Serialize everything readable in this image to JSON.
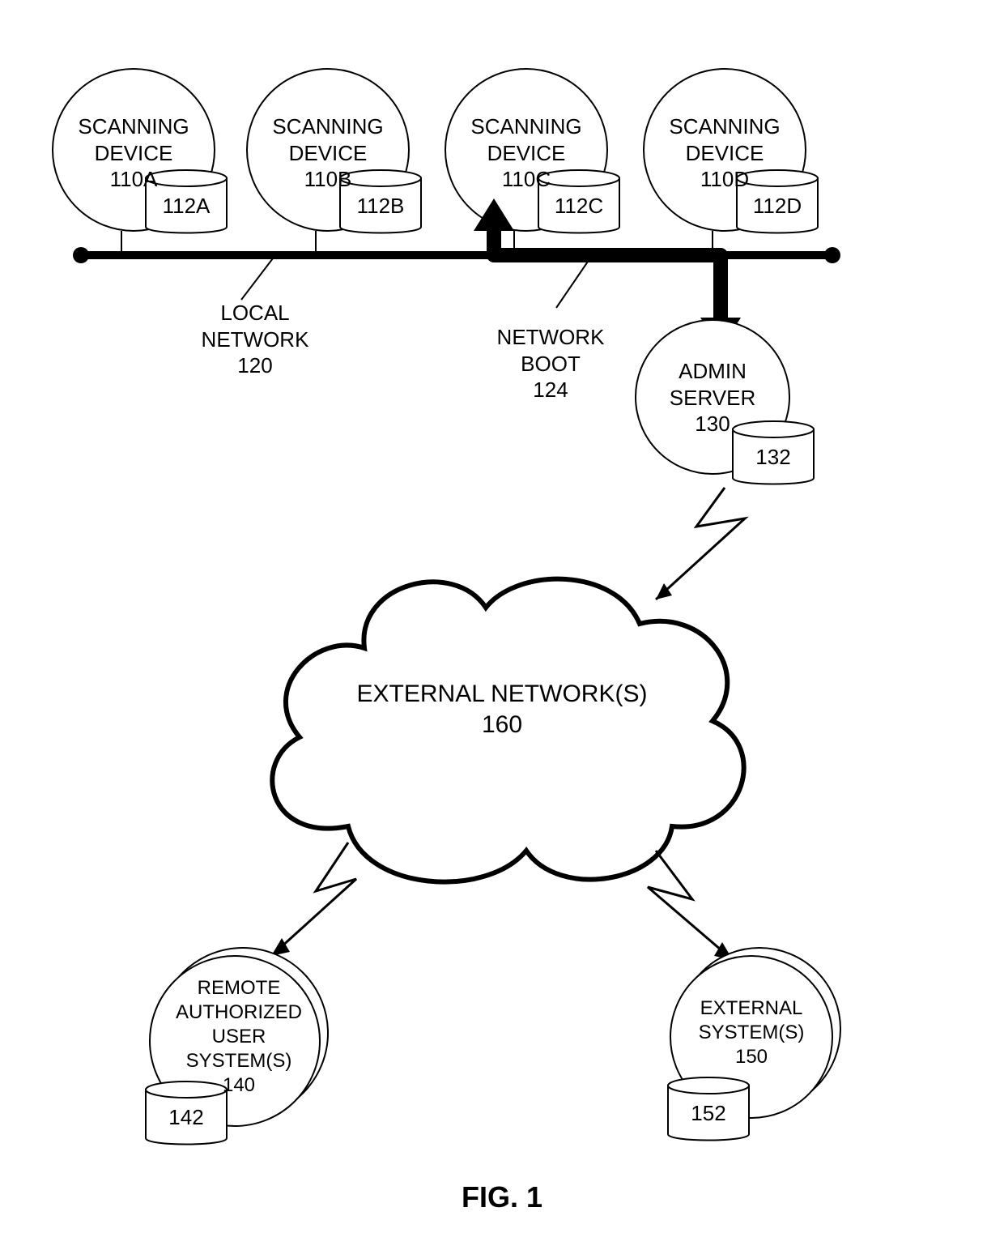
{
  "scanning_devices": [
    {
      "title": "SCANNING\nDEVICE\n110A",
      "storage_label": "112A"
    },
    {
      "title": "SCANNING\nDEVICE\n110B",
      "storage_label": "112B"
    },
    {
      "title": "SCANNING\nDEVICE\n110C",
      "storage_label": "112C"
    },
    {
      "title": "SCANNING\nDEVICE\n110D",
      "storage_label": "112D"
    }
  ],
  "local_network_label": "LOCAL\nNETWORK\n120",
  "network_boot_label": "NETWORK\nBOOT\n124",
  "admin_server": {
    "title": "ADMIN\nSERVER\n130",
    "storage_label": "132"
  },
  "cloud_label": "EXTERNAL NETWORK(S)\n160",
  "remote_user": {
    "title": "REMOTE\nAUTHORIZED\nUSER\nSYSTEM(S)\n140",
    "storage_label": "142"
  },
  "external_system": {
    "title": "EXTERNAL\nSYSTEM(S)\n150",
    "storage_label": "152"
  },
  "figure_label": "FIG. 1"
}
